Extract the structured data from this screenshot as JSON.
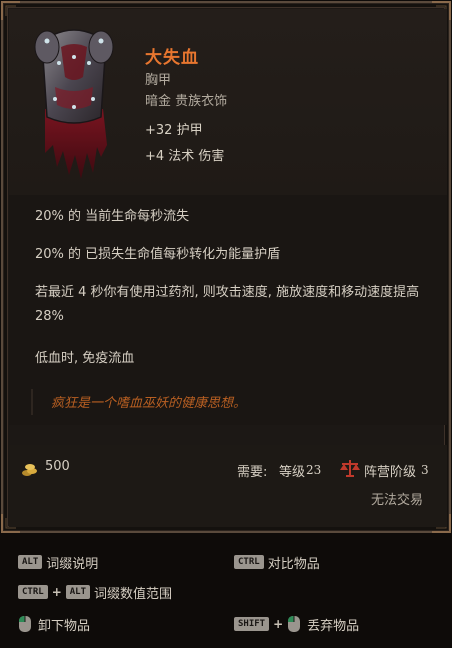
{
  "item": {
    "name": "大失血",
    "slot": "胸甲",
    "rarity": "暗金 贵族衣饰",
    "implicits": [
      "+32 护甲",
      "+4 法术 伤害"
    ],
    "affixes": [
      "20% 的 当前生命每秒流失",
      "20% 的 已损失生命值每秒转化为能量护盾",
      "若最近 4 秒你有使用过药剂, 则攻击速度, 施放速度和移动速度提高 28%",
      "低血时, 免疫流血"
    ],
    "flavor": "疯狂是一个嗜血巫妖的健康思想。"
  },
  "footer": {
    "gold": "500",
    "requirement_label": "需要:",
    "level_label": "等级",
    "level_value": "23",
    "faction_label": "阵营阶级",
    "faction_value": "3",
    "trade_status": "无法交易"
  },
  "hints": {
    "affix_desc": {
      "keys": [
        "ALT"
      ],
      "label": "词缀说明"
    },
    "compare": {
      "keys": [
        "CTRL"
      ],
      "label": "对比物品"
    },
    "affix_range": {
      "keys": [
        "CTRL",
        "ALT"
      ],
      "label": "词缀数值范围"
    },
    "unequip": {
      "mouse": "left-click",
      "label": "卸下物品"
    },
    "drop": {
      "keys": [
        "SHIFT"
      ],
      "mouse": "left-click",
      "label": "丢弃物品"
    }
  },
  "colors": {
    "item_name": "#e8762f",
    "flavor": "#b85f22",
    "frame": "#5a4a3c",
    "background": "#1c1815"
  }
}
